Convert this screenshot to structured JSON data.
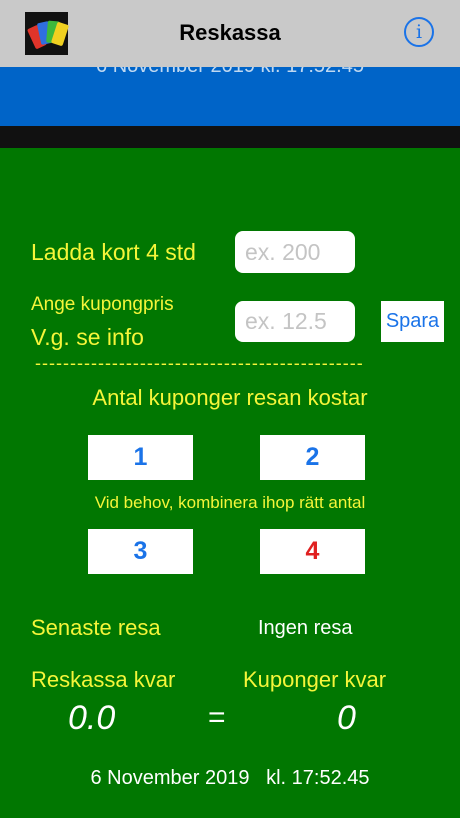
{
  "nav": {
    "title": "Reskassa",
    "info_glyph": "i",
    "app_icon": "cards-app-icon"
  },
  "background_date": "6 November 2019  kl. 17:52.45",
  "charge": {
    "label": "Ladda kort 4 std",
    "placeholder": "ex. 200",
    "value": ""
  },
  "coupon_price": {
    "label_line1": "Ange kupongpris",
    "label_line2": "V.g. se info",
    "placeholder": "ex. 12.5",
    "value": "",
    "save_label": "Spara"
  },
  "divider_text": "-----------------------------------------------",
  "coupons": {
    "heading": "Antal kuponger resan kostar",
    "buttons": [
      "1",
      "2",
      "3",
      "4"
    ],
    "hint": "Vid behov, kombinera ihop rätt antal"
  },
  "last_trip": {
    "label": "Senaste resa",
    "value": "Ingen resa"
  },
  "balance": {
    "cash_label": "Reskassa kvar",
    "coupons_label": "Kuponger kvar",
    "cash_value": "0.0",
    "equals": "=",
    "coupons_value": "0"
  },
  "footer": {
    "date": "6 November 2019",
    "time": "kl. 17:52.45"
  },
  "colors": {
    "background": "#017701",
    "accent_blue": "#0064c8",
    "label_yellow": "#f5f53a",
    "button_text_blue": "#1a73e8",
    "button_4_red": "#e02020"
  }
}
